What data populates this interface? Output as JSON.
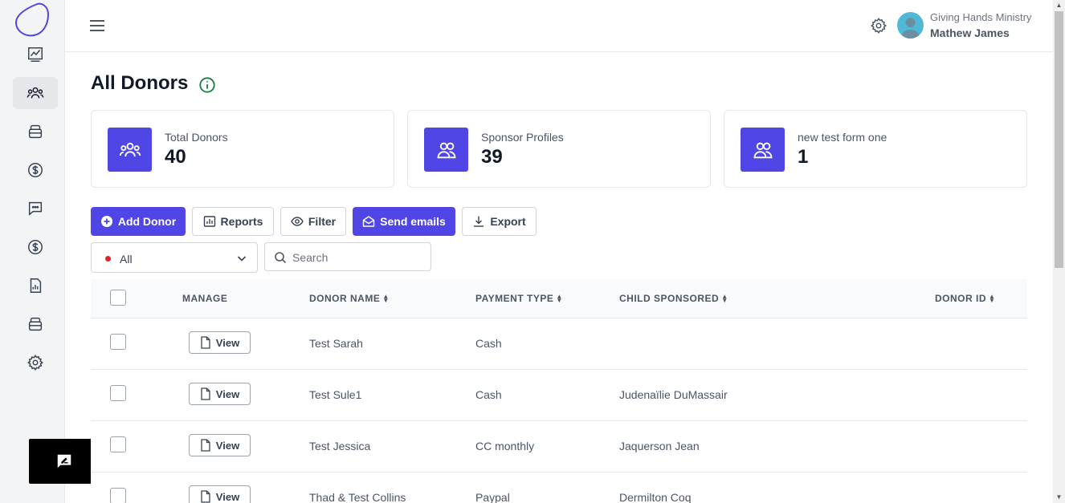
{
  "header": {
    "org_name": "Giving Hands Ministry",
    "user_name": "Mathew James"
  },
  "page": {
    "title": "All Donors"
  },
  "stats": [
    {
      "label": "Total Donors",
      "value": "40",
      "icon": "users-group-icon"
    },
    {
      "label": "Sponsor Profiles",
      "value": "39",
      "icon": "users-icon"
    },
    {
      "label": "new test form one",
      "value": "1",
      "icon": "users-icon"
    }
  ],
  "toolbar": {
    "add_donor": "Add Donor",
    "reports": "Reports",
    "filter": "Filter",
    "send_emails": "Send emails",
    "export": "Export"
  },
  "filter_select": {
    "value": "All"
  },
  "search": {
    "placeholder": "Search"
  },
  "table": {
    "columns": [
      "MANAGE",
      "DONOR NAME",
      "PAYMENT TYPE",
      "CHILD SPONSORED",
      "DONOR ID"
    ],
    "view_label": "View",
    "rows": [
      {
        "donor_name": "Test Sarah",
        "payment_type": "Cash",
        "child_sponsored": "",
        "donor_id": ""
      },
      {
        "donor_name": "Test Sule1",
        "payment_type": "Cash",
        "child_sponsored": "Judenaïlie DuMassair",
        "donor_id": ""
      },
      {
        "donor_name": "Test Jessica",
        "payment_type": "CC monthly",
        "child_sponsored": "Jaquerson Jean",
        "donor_id": ""
      },
      {
        "donor_name": "Thad & Test Collins",
        "payment_type": "Paypal",
        "child_sponsored": "Dermilton Coq",
        "donor_id": ""
      }
    ]
  },
  "colors": {
    "accent": "#4f46e5",
    "info": "#15803d",
    "sidebar_bg": "#f3f4f6"
  }
}
